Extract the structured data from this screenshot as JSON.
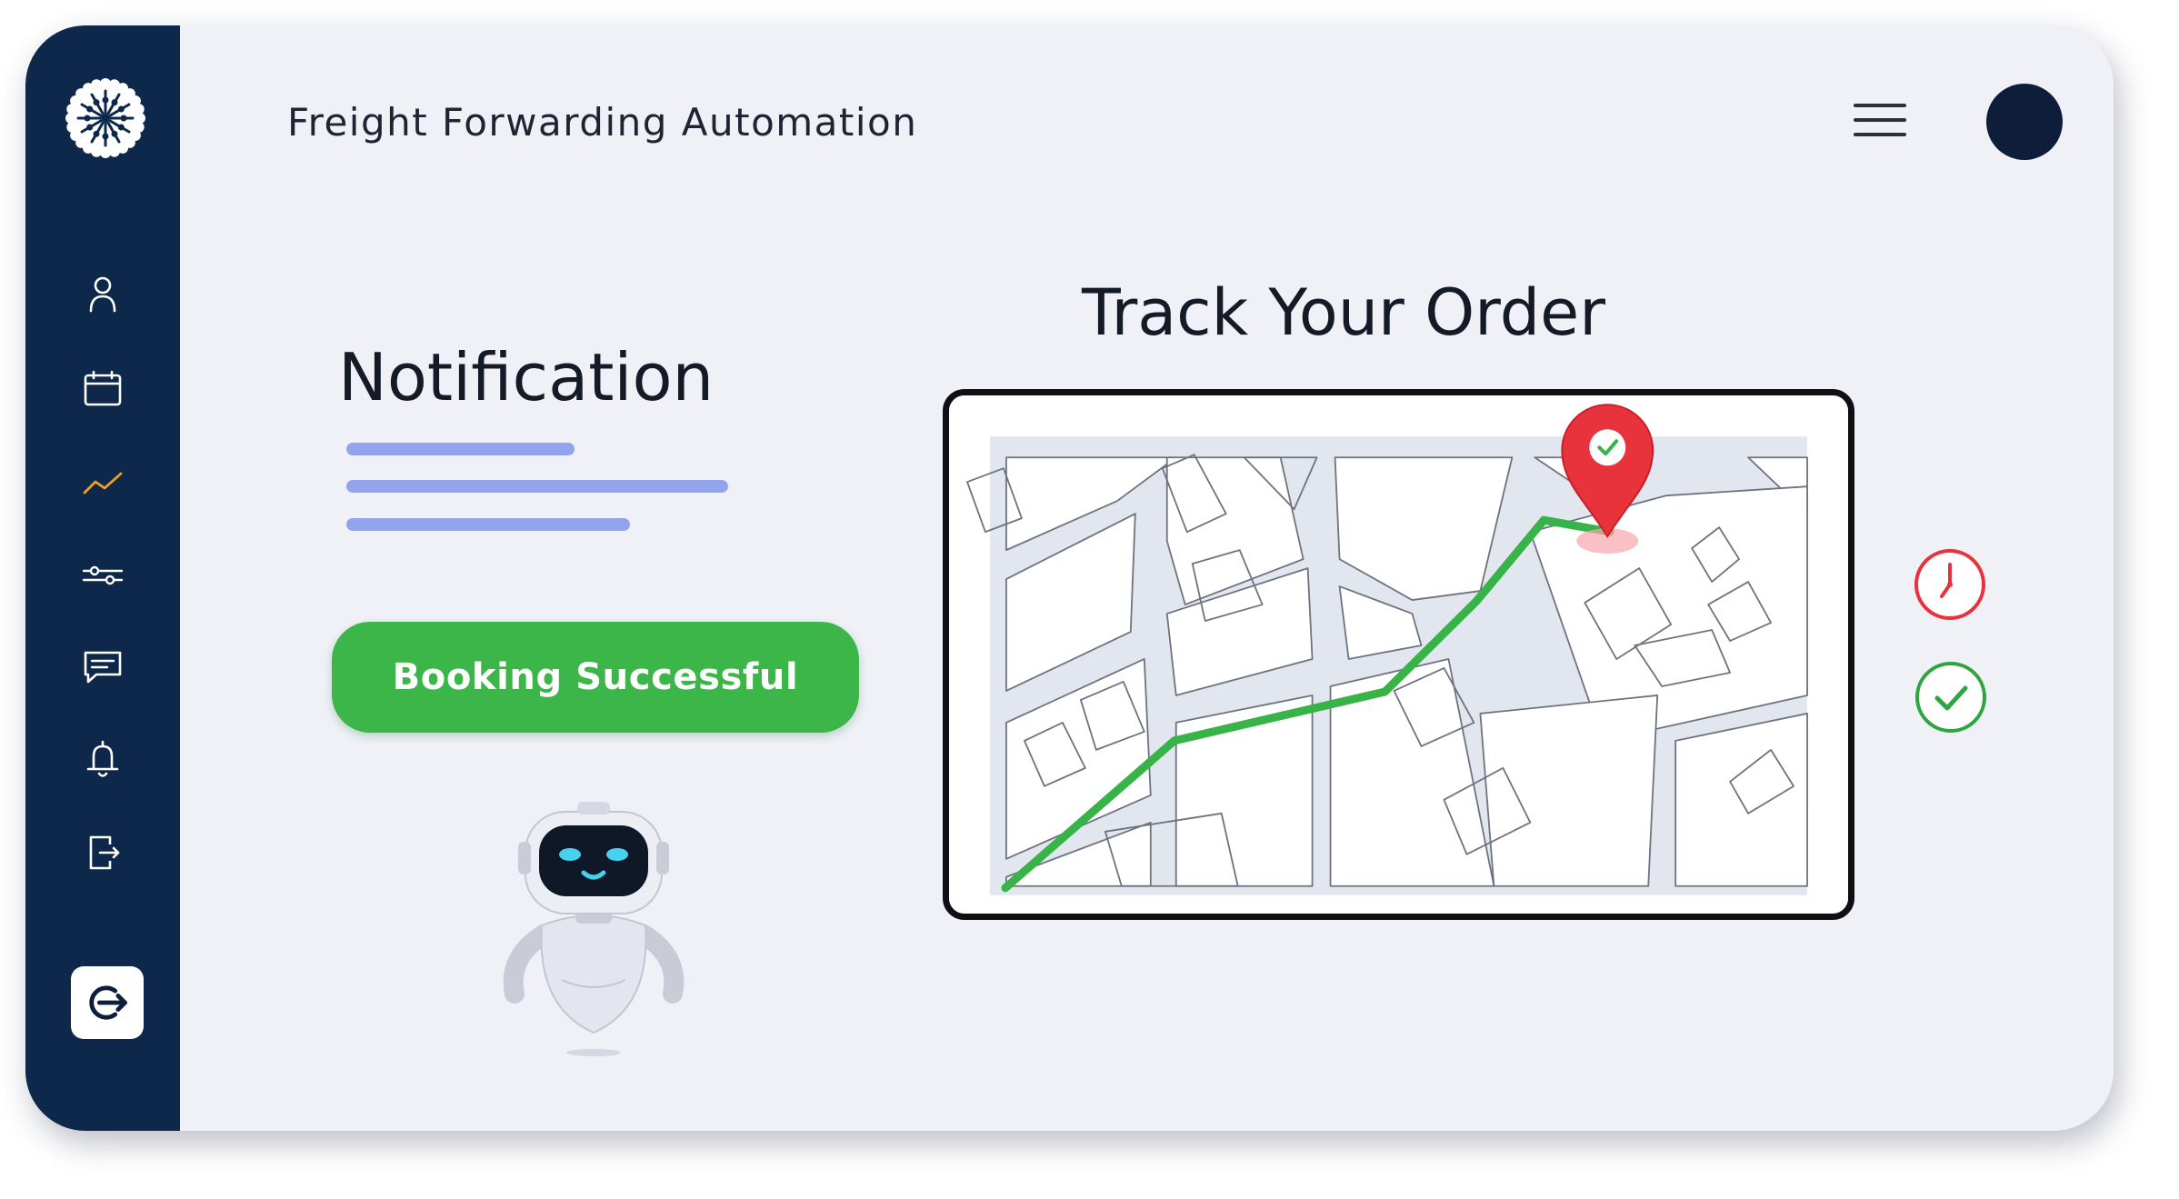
{
  "header": {
    "title": "Freight Forwarding Automation"
  },
  "sidebar": {
    "logo": "snowflake-gear-logo",
    "items": [
      {
        "icon": "user-icon",
        "active": false
      },
      {
        "icon": "calendar-icon",
        "active": false
      },
      {
        "icon": "trend-chart-icon",
        "active": true
      },
      {
        "icon": "sliders-icon",
        "active": false
      },
      {
        "icon": "message-icon",
        "active": false
      },
      {
        "icon": "bell-icon",
        "active": false
      },
      {
        "icon": "file-export-icon",
        "active": false
      }
    ],
    "bottom_button": "logout-icon"
  },
  "notification": {
    "title": "Notification",
    "button_label": "Booking Successful"
  },
  "tracking": {
    "title": "Track Your Order",
    "status_icons": [
      "clock-icon",
      "check-circle-icon"
    ]
  },
  "colors": {
    "sidebar": "#0d284b",
    "background": "#eff1f7",
    "success": "#3cb648",
    "accent_active": "#f0a020",
    "pin": "#e8323c",
    "skeleton": "#93a4ef",
    "avatar": "#0d1d3a"
  }
}
